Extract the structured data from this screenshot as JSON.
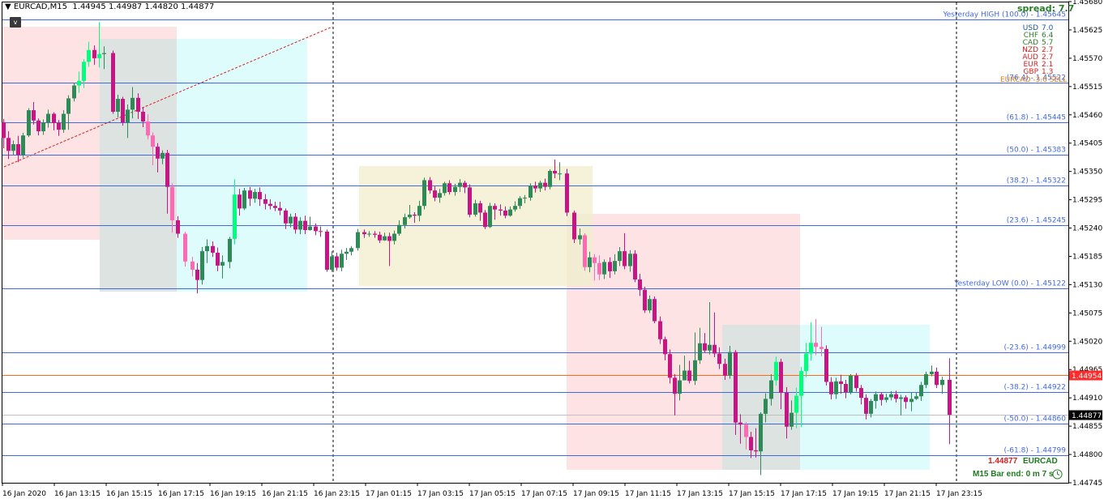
{
  "header": {
    "menu_arrow": "▼",
    "symbol_timeframe": "EURCAD,M15",
    "ohlc": "1.44945 1.44987 1.44820 1.44877",
    "v_button": "v"
  },
  "spread": "spread: 7.7",
  "currency_strength": [
    {
      "currency": "USD",
      "value": "7.0",
      "color": "#1e5aa8"
    },
    {
      "currency": "CHF",
      "value": "6.4",
      "color": "#2a7d2a"
    },
    {
      "currency": "CAD",
      "value": "5.7",
      "color": "#2a7d2a"
    },
    {
      "currency": "NZD",
      "value": "2.7",
      "color": "#d62020"
    },
    {
      "currency": "AUD",
      "value": "2.7",
      "color": "#d62020"
    },
    {
      "currency": "EUR",
      "value": "2.1",
      "color": "#d62020"
    },
    {
      "currency": "GBP",
      "value": "1.3",
      "color": "#d62020"
    }
  ],
  "pair_strength": "EURCAD -3.6 SELL",
  "price_info": {
    "price": "1.44877",
    "symbol": "EURCAD"
  },
  "bar_end": "M15 Bar end: 0 m 7 s",
  "colors": {
    "bull": "#2e8b57",
    "bull_bright": "#00ff7f",
    "bear": "#c71585",
    "bear_light": "#ff69b4",
    "fib_line": "#4169e1",
    "fib_label": "#4169e1",
    "current_line": "#ff6a1a",
    "bid_tag": "#ff2a2a",
    "ask_tag": "#000000"
  },
  "chart_data": {
    "type": "candlestick",
    "symbol": "EURCAD",
    "timeframe": "M15",
    "ylim": [
      1.44745,
      1.4568
    ],
    "y_ticks": [
      "1.45680",
      "1.45625",
      "1.45570",
      "1.45515",
      "1.45460",
      "1.45405",
      "1.45350",
      "1.45295",
      "1.45240",
      "1.45185",
      "1.45130",
      "1.45075",
      "1.45020",
      "1.44965",
      "1.44910",
      "1.44855",
      "1.44800",
      "1.44745"
    ],
    "x_labels": [
      "16 Jan 2020",
      "16 Jan 13:15",
      "16 Jan 15:15",
      "16 Jan 17:15",
      "16 Jan 19:15",
      "16 Jan 21:15",
      "16 Jan 23:15",
      "17 Jan 01:15",
      "17 Jan 03:15",
      "17 Jan 05:15",
      "17 Jan 07:15",
      "17 Jan 09:15",
      "17 Jan 11:15",
      "17 Jan 13:15",
      "17 Jan 15:15",
      "17 Jan 17:15",
      "17 Jan 19:15",
      "17 Jan 21:15",
      "17 Jan 23:15"
    ],
    "fib_levels": [
      {
        "label": "Yesterday HIGH (100.0) - 1.45645",
        "price": 1.45645
      },
      {
        "label": "(76.4) - 1.45522",
        "price": 1.45522
      },
      {
        "label": "(61.8) - 1.45445",
        "price": 1.45445
      },
      {
        "label": "(50.0) - 1.45383",
        "price": 1.45383
      },
      {
        "label": "(38.2) - 1.45322",
        "price": 1.45322
      },
      {
        "label": "(23.6) - 1.45245",
        "price": 1.45245
      },
      {
        "label": "Yesterday LOW (0.0) - 1.45122",
        "price": 1.45122
      },
      {
        "label": "(-23.6) - 1.44999",
        "price": 1.44999
      },
      {
        "label": "(-38.2) - 1.44922",
        "price": 1.44922
      },
      {
        "label": "(-50.0) - 1.44860",
        "price": 1.4486
      },
      {
        "label": "(-61.8) - 1.44799",
        "price": 1.44799
      }
    ],
    "bid_price": "1.44954",
    "ask_price": "1.44877",
    "bid_value": 1.44954,
    "ask_value": 1.44877,
    "grid": false,
    "candles": []
  }
}
